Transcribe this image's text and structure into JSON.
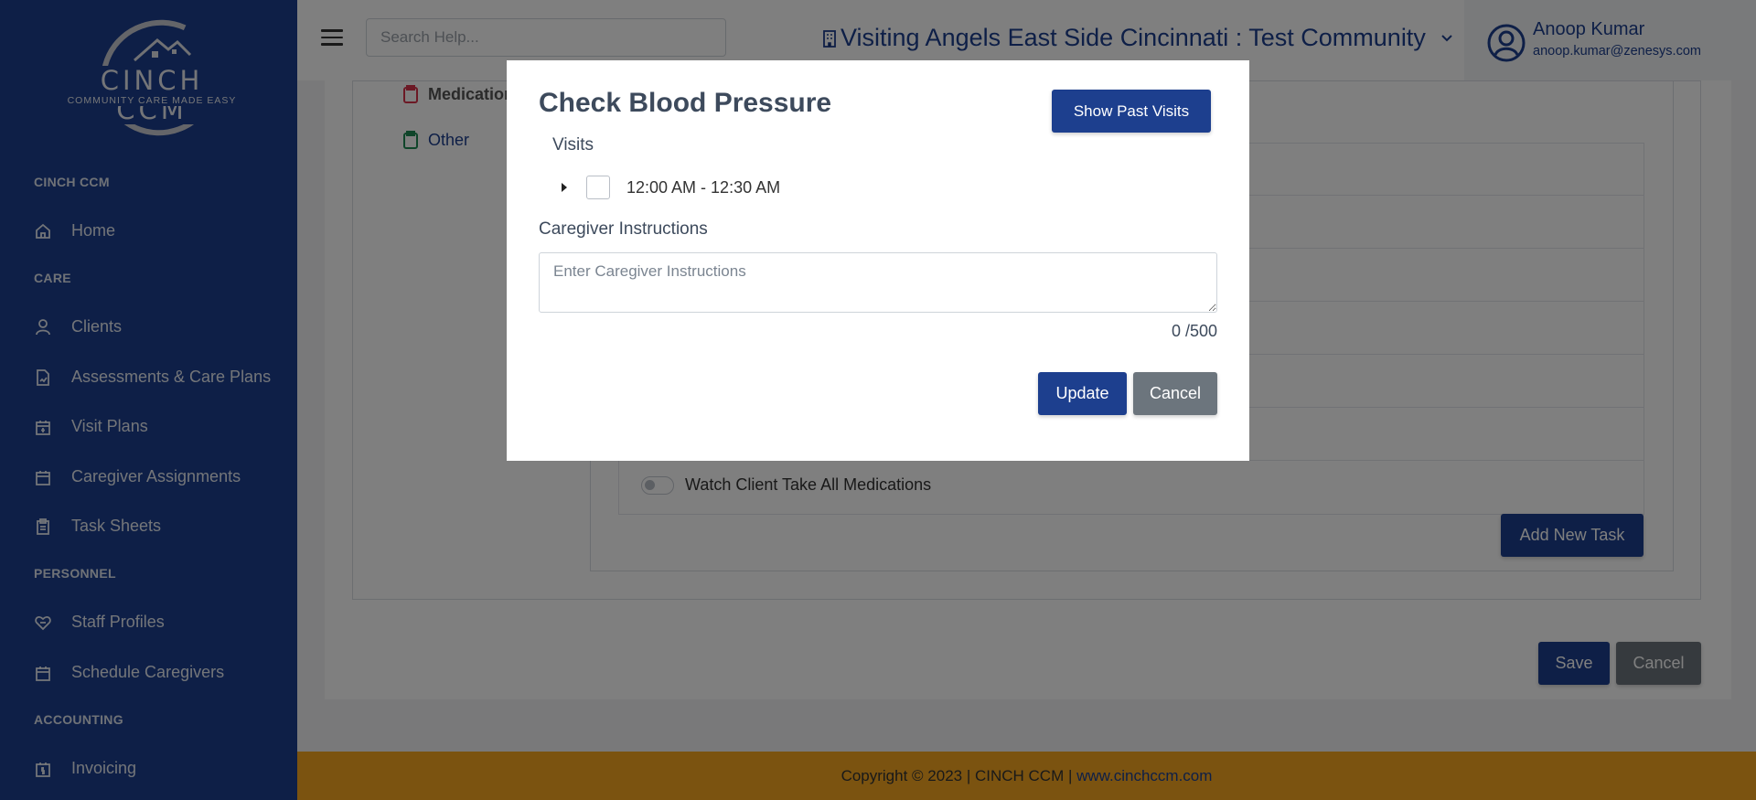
{
  "sidebar": {
    "brand": "CINCH CCM",
    "tagline": "COMMUNITY CARE MADE EASY",
    "sections": {
      "cinch": "CINCH CCM",
      "care": "CARE",
      "personnel": "PERSONNEL",
      "accounting": "ACCOUNTING"
    },
    "items": {
      "home": "Home",
      "clients": "Clients",
      "assessments": "Assessments & Care Plans",
      "visit_plans": "Visit Plans",
      "caregiver_assignments": "Caregiver Assignments",
      "task_sheets": "Task Sheets",
      "staff_profiles": "Staff Profiles",
      "schedule_caregivers": "Schedule Caregivers",
      "invoicing": "Invoicing"
    }
  },
  "topbar": {
    "search_placeholder": "Search Help...",
    "community": "Visiting Angels East Side Cincinnati : Test Community",
    "user_name": "Anoop Kumar",
    "user_email": "anoop.kumar@zenesys.com"
  },
  "background": {
    "side_links": {
      "medication": "Medication",
      "other": "Other"
    },
    "task_item": "Watch Client Take All Medications",
    "add_task_label": "Add New Task",
    "save_label": "Save",
    "cancel_label": "Cancel"
  },
  "footer": {
    "text": "Copyright © 2023 | CINCH CCM | ",
    "link": "www.cinchccm.com"
  },
  "modal": {
    "title": "Check Blood Pressure",
    "show_past_visits_label": "Show Past Visits",
    "visits_label": "Visits",
    "visit_time": "12:00 AM - 12:30 AM",
    "instructions_label": "Caregiver Instructions",
    "instructions_placeholder": "Enter Caregiver Instructions",
    "instructions_value": "",
    "counter": "0 /500",
    "update_label": "Update",
    "cancel_label": "Cancel"
  },
  "colors": {
    "brand_blue": "#1d3f8e",
    "footer_orange": "#f6a721",
    "secondary_gray": "#6c757d"
  }
}
